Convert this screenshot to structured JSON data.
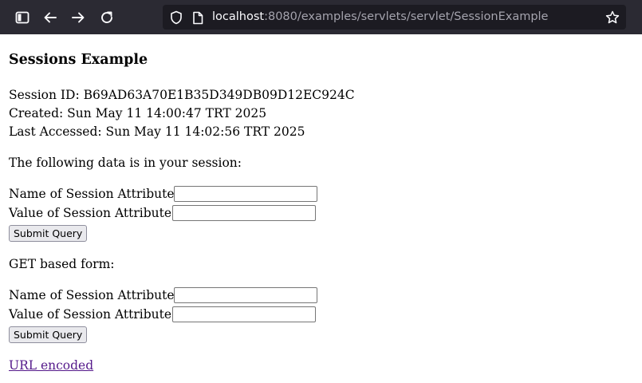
{
  "browser": {
    "url_host": "localhost",
    "url_rest": ":8080/examples/servlets/servlet/SessionExample"
  },
  "page": {
    "title": "Sessions Example",
    "session_id_line": "Session ID: B69AD63A70E1B35D349DB09D12EC924C",
    "created_line": "Created: Sun May 11 14:00:47 TRT 2025",
    "last_accessed_line": "Last Accessed: Sun May 11 14:02:56 TRT 2025",
    "data_intro": "The following data is in your session:",
    "post_form": {
      "name_label": "Name of Session Attribute:",
      "value_label": "Value of Session Attribute:",
      "name_value": "",
      "value_value": "",
      "submit_label": "Submit Query"
    },
    "get_form_heading": "GET based form:",
    "get_form": {
      "name_label": "Name of Session Attribute:",
      "value_label": "Value of Session Attribute:",
      "name_value": "",
      "value_value": "",
      "submit_label": "Submit Query"
    },
    "url_encoded_link": "URL encoded"
  },
  "colors": {
    "toolbar_bg": "#2b2a33",
    "urlbar_bg": "#1c1b22",
    "visited_link": "#551a8b"
  },
  "icons": [
    "sidebar-icon",
    "back-arrow-icon",
    "forward-arrow-icon",
    "reload-icon",
    "shield-icon",
    "page-icon",
    "bookmark-star-icon"
  ]
}
